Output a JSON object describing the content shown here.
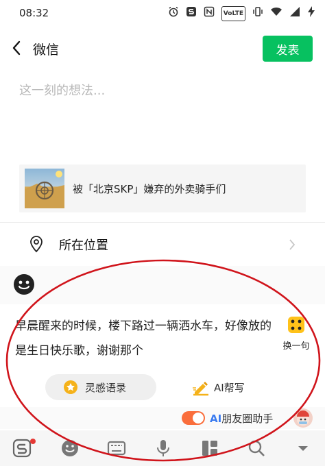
{
  "status_bar": {
    "time": "08:32",
    "icons": [
      "alarm-icon",
      "s-app-icon",
      "nfc-icon",
      "volte-icon",
      "vibrate-icon",
      "wifi-icon",
      "signal-icon",
      "charging-icon"
    ],
    "volte_label": "VoLTE"
  },
  "nav": {
    "title": "微信",
    "publish_label": "发表"
  },
  "compose": {
    "placeholder": "这一刻的想法..."
  },
  "link_card": {
    "title": "被「北京SKP」嫌弃的外卖骑手们"
  },
  "location": {
    "label": "所在位置"
  },
  "suggestion": {
    "text": "早晨醒来的时候，楼下路过一辆洒水车，好像放的是生日快乐歌，谢谢那个",
    "swap_label": "换一句",
    "inspiration_label": "灵感语录",
    "ai_write_label": "AI帮写"
  },
  "assistant": {
    "ai_prefix": "AI",
    "label": "朋友圈助手",
    "toggle_on": true
  },
  "colors": {
    "accent_green": "#07c160",
    "toggle_orange": "#fa6e3c",
    "ai_blue": "#3a7bf0",
    "annotation_red": "#d0141b"
  }
}
